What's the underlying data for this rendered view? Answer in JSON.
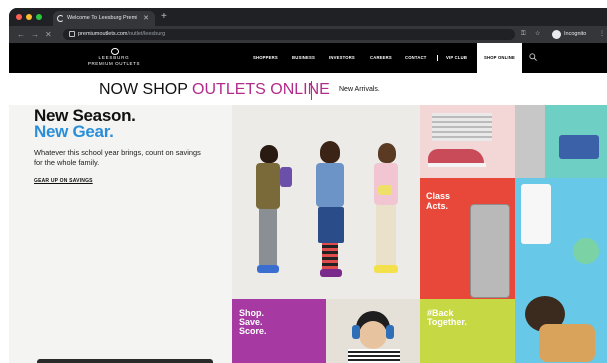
{
  "browser": {
    "tab_title": "Welcome To Leesburg Premiu",
    "url_domain": "premiumoutlets.com",
    "url_path": "/outlet/leesburg",
    "profile_label": "Incognito"
  },
  "site": {
    "logo_line1": "LEESBURG",
    "logo_line2": "PREMIUM OUTLETS",
    "nav": [
      "SHOPPERS",
      "BUSINESS",
      "INVESTORS",
      "CAREERS",
      "CONTACT",
      "VIP CLUB"
    ],
    "nav_active": "SHOP ONLINE"
  },
  "banner": {
    "headline_plain": "NOW SHOP ",
    "headline_accent": "OUTLETS ONLINE",
    "subtext": "New Arrivals."
  },
  "hero": {
    "title_line1": "New Season.",
    "title_line2": "New Gear.",
    "description": "Whatever this school year brings, count on savings for the whole family.",
    "cta": "GEAR UP ON SAVINGS"
  },
  "tiles": {
    "red": [
      "Class",
      "Acts."
    ],
    "purple": [
      "Shop.",
      "Save.",
      "Score."
    ],
    "lime": [
      "#Back",
      "Together."
    ]
  },
  "colors": {
    "accent_pink": "#b22c8a",
    "accent_blue": "#2a8fd8",
    "tile_red": "#e8483a",
    "tile_purple": "#a63aa2",
    "tile_lime": "#c6d843"
  }
}
